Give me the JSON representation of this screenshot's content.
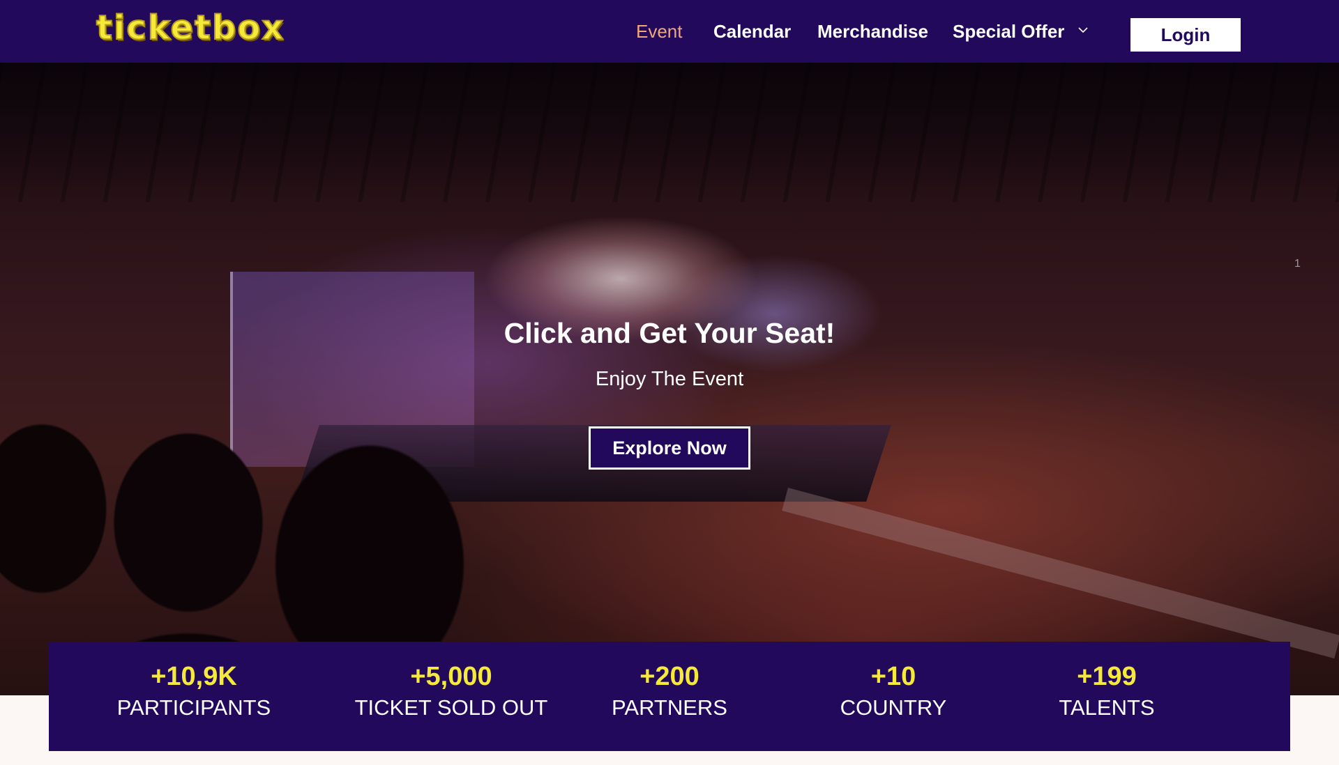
{
  "brand": {
    "logo_text": "ticketbox",
    "colors": {
      "primary": "#22095c",
      "accent_yellow": "#f5ea3a",
      "active_link": "#f0a77a",
      "page_background": "#fcf6f4"
    }
  },
  "nav": {
    "links": [
      {
        "label": "Event",
        "active": true
      },
      {
        "label": "Calendar",
        "active": false
      },
      {
        "label": "Merchandise",
        "active": false
      },
      {
        "label": "Special Offer",
        "active": false,
        "icon": "chevron-down-icon"
      }
    ],
    "login_label": "Login"
  },
  "hero": {
    "title": "Click and Get Your Seat!",
    "subtitle": "Enjoy The Event",
    "cta_label": "Explore Now",
    "slide_indicator": "1",
    "background": "concert-arena-photo"
  },
  "stats": [
    {
      "value": "+10,9K",
      "label": "PARTICIPANTS"
    },
    {
      "value": "+5,000",
      "label": "TICKET SOLD OUT"
    },
    {
      "value": "+200",
      "label": "PARTNERS"
    },
    {
      "value": "+10",
      "label": "COUNTRY"
    },
    {
      "value": "+199",
      "label": "TALENTS"
    }
  ]
}
